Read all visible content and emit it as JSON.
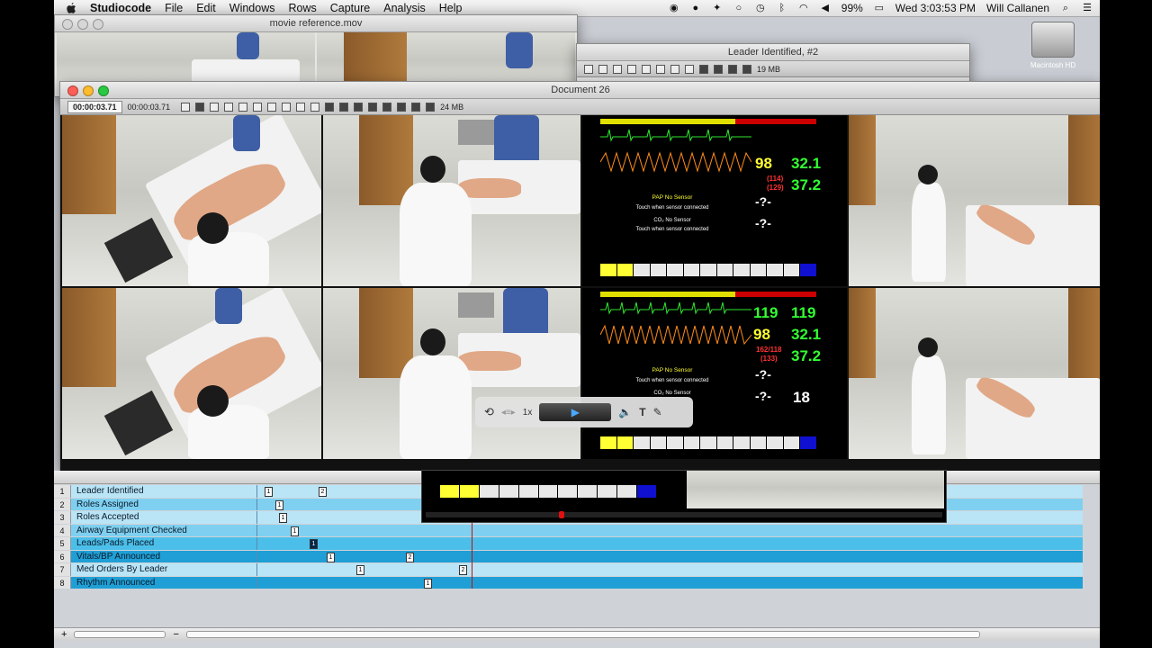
{
  "menubar": {
    "app": "Studiocode",
    "items": [
      "File",
      "Edit",
      "Windows",
      "Rows",
      "Capture",
      "Analysis",
      "Help"
    ],
    "battery": "99%",
    "clock": "Wed 3:03:53 PM",
    "user": "Will Callanen"
  },
  "desktop": {
    "hd_label": "Macintosh HD"
  },
  "windows": {
    "movie_ref": {
      "title": "movie reference.mov"
    },
    "leader": {
      "title": "Leader Identified, #2",
      "size": "19 MB"
    },
    "document": {
      "title": "Document  26",
      "timecode_a": "00:00:03.71",
      "timecode_b": "00:00:03.71",
      "size": "24 MB"
    }
  },
  "monitor": {
    "pap_text": "PAP No Sensor",
    "touch_text": "Touch when sensor connected",
    "co2_text": "CO₂ No Sensor",
    "top": {
      "hr": "98",
      "spo2": "32.1",
      "temp": "37.2",
      "bp": "(114)",
      "bp2": "(129)",
      "q1": "-?-",
      "q2": "-?-"
    },
    "bottom": {
      "hr_a": "119",
      "hr_b": "119",
      "spo2a": "98",
      "spo2b": "32.1",
      "temp": "37.2",
      "bp": "162/118",
      "bp2": "(133)",
      "q1": "-?-",
      "q2": "-?-",
      "rr": "18"
    }
  },
  "hud": {
    "speed": "1x"
  },
  "timeline": {
    "rows": [
      {
        "n": "1",
        "label": "Leader Identified"
      },
      {
        "n": "2",
        "label": "Roles Assigned"
      },
      {
        "n": "3",
        "label": "Roles Accepted"
      },
      {
        "n": "4",
        "label": "Airway Equipment Checked"
      },
      {
        "n": "5",
        "label": "Leads/Pads Placed"
      },
      {
        "n": "6",
        "label": "Vitals/BP Announced"
      },
      {
        "n": "7",
        "label": "Med Orders By Leader"
      },
      {
        "n": "8",
        "label": "Rhythm Announced"
      }
    ],
    "instances": {
      "r1a": "1",
      "r1b": "2",
      "r2": "1",
      "r3": "1",
      "r4": "1",
      "r5": "1",
      "r6a": "1",
      "r6b": "2",
      "r7a": "1",
      "r7b": "2",
      "r8": "1"
    },
    "colors": {
      "light": "#7fd0f0",
      "mid": "#4bbfe9",
      "dark": "#1f9fd6",
      "alt": "#b9e5f6"
    }
  },
  "footer": {
    "add": "+",
    "remove": "−"
  }
}
